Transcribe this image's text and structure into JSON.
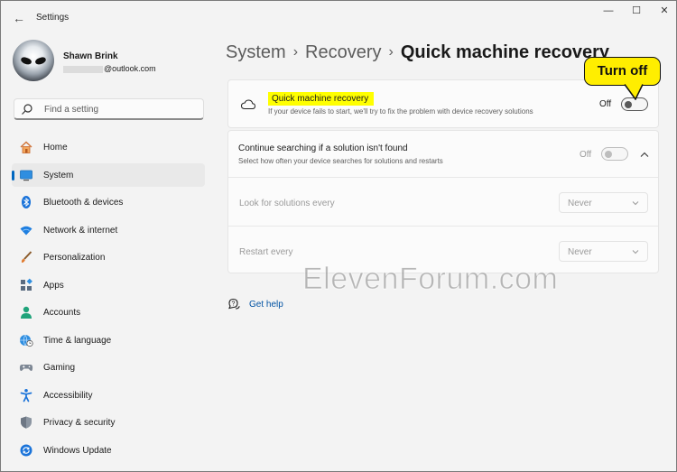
{
  "window": {
    "app_title": "Settings",
    "back_glyph": "←",
    "controls": {
      "minimize": "—",
      "maximize": "☐",
      "close": "✕"
    }
  },
  "user": {
    "name": "Shawn Brink",
    "email_visible": "@outlook.com"
  },
  "search": {
    "placeholder": "Find a setting",
    "icon": "search-icon"
  },
  "sidebar": {
    "items": [
      {
        "label": "Home",
        "icon": "home-icon",
        "selected": false
      },
      {
        "label": "System",
        "icon": "system-monitor-icon",
        "selected": true
      },
      {
        "label": "Bluetooth & devices",
        "icon": "bluetooth-icon",
        "selected": false
      },
      {
        "label": "Network & internet",
        "icon": "wifi-icon",
        "selected": false
      },
      {
        "label": "Personalization",
        "icon": "brush-icon",
        "selected": false
      },
      {
        "label": "Apps",
        "icon": "apps-icon",
        "selected": false
      },
      {
        "label": "Accounts",
        "icon": "person-icon",
        "selected": false
      },
      {
        "label": "Time & language",
        "icon": "globe-clock-icon",
        "selected": false
      },
      {
        "label": "Gaming",
        "icon": "gamepad-icon",
        "selected": false
      },
      {
        "label": "Accessibility",
        "icon": "accessibility-icon",
        "selected": false
      },
      {
        "label": "Privacy & security",
        "icon": "shield-icon",
        "selected": false
      },
      {
        "label": "Windows Update",
        "icon": "update-icon",
        "selected": false
      }
    ]
  },
  "breadcrumb": {
    "items": [
      "System",
      "Recovery"
    ],
    "separator": "›",
    "current": "Quick machine recovery"
  },
  "qmr": {
    "title": "Quick machine recovery",
    "description": "If your device fails to start, we'll try to fix the problem with device recovery solutions",
    "toggle_label": "Off",
    "toggle_on": false
  },
  "continue_search": {
    "title": "Continue searching if a solution isn't found",
    "description": "Select how often your device searches for solutions and restarts",
    "toggle_label": "Off",
    "toggle_on": false,
    "expanded": true
  },
  "look_for": {
    "label": "Look for solutions every",
    "value": "Never"
  },
  "restart": {
    "label": "Restart every",
    "value": "Never"
  },
  "help": {
    "label": "Get help"
  },
  "watermark": "ElevenForum.com",
  "callout": {
    "text": "Turn off"
  },
  "colors": {
    "accent": "#0067c0",
    "highlight": "#ffff00",
    "callout": "#ffee00"
  }
}
